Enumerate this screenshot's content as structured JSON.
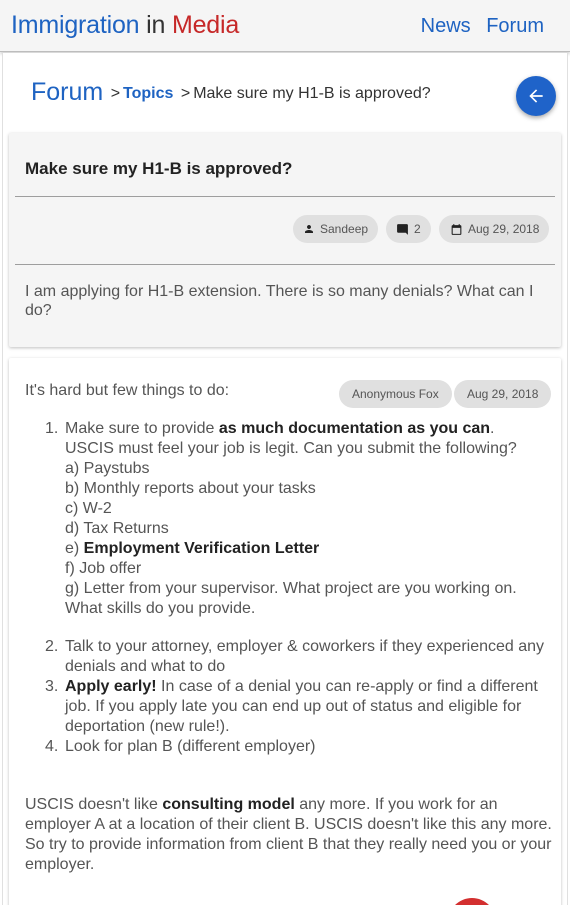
{
  "appbar": {
    "brand": {
      "part1": "Immigration",
      "part2": "in",
      "part3": "Media"
    },
    "nav": [
      {
        "label": "News"
      },
      {
        "label": "Forum"
      }
    ]
  },
  "breadcrumb": {
    "root": "Forum",
    "sep1": ">",
    "topics": "Topics",
    "sep2": ">",
    "current": "Make sure my H1-B is approved?"
  },
  "question": {
    "title": "Make sure my H1-B is approved?",
    "author": "Sandeep",
    "replies": "2",
    "date": "Aug 29, 2018",
    "body": "I am applying for H1-B extension. There is so many denials? What can I do?"
  },
  "answer": {
    "intro": "It's hard but few things to do:",
    "author": "Anonymous Fox",
    "date": "Aug 29, 2018",
    "items": [
      {
        "num": "1.",
        "pre": "Make sure to provide ",
        "bold": "as much documentation as you can",
        "post": ". USCIS must feel your job is legit. Can you submit the following?"
      },
      {
        "num": "2.",
        "text": "Talk to your attorney, employer & coworkers if they experienced any denials and what to do"
      },
      {
        "num": "3.",
        "bold": "Apply early!",
        "post": " In case of a denial you can re-apply or find a different job. If you apply late you can end up out of status and eligible for deportation (new rule!)."
      },
      {
        "num": "4.",
        "text": "Look for plan B (different employer)"
      }
    ],
    "subitems": [
      {
        "text": "a) Paystubs"
      },
      {
        "text": "b) Monthly reports about your tasks"
      },
      {
        "text": "c) W-2"
      },
      {
        "text": "d) Tax Returns"
      },
      {
        "pre": "e) ",
        "bold": "Employment Verification Letter"
      },
      {
        "text": "f) Job offer"
      },
      {
        "text": "g) Letter from your supervisor. What project are you working on. What skills do you provide."
      }
    ],
    "outro": {
      "pre": "USCIS doesn't like ",
      "bold": "consulting model",
      "post": " any more. If you work for an employer A at a location of their client B. USCIS doesn't like this any more. So try to provide information from client B that they really need you or your employer."
    }
  },
  "colors": {
    "brand_blue": "#1e63c2",
    "brand_red": "#c62828",
    "back_button": "#1f63c9",
    "fab": "#d32f2f"
  },
  "icons": {
    "back": "arrow-left-icon",
    "author": "person-icon",
    "replies": "comment-icon",
    "date": "calendar-icon"
  }
}
